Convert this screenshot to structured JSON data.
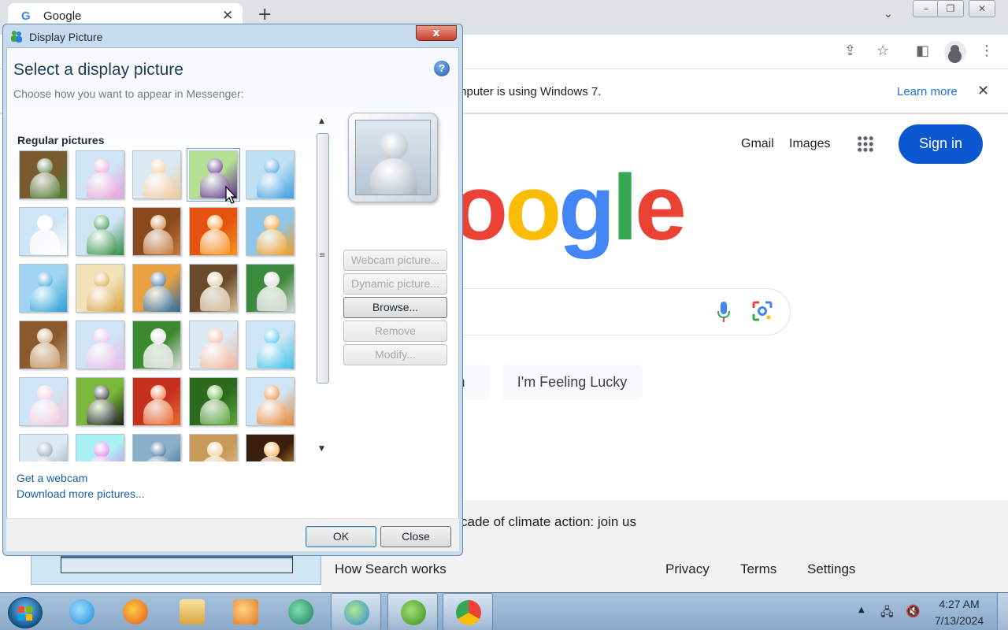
{
  "browser": {
    "tab_title": "Google",
    "tab_favicon": "G",
    "new_tab_symbol": "+",
    "infobar_text": "mputer is using Windows 7.",
    "learn_more": "Learn more",
    "icons": [
      "share-icon",
      "star-icon",
      "sidepanel-icon",
      "profile-icon",
      "kebab-menu-icon"
    ]
  },
  "google": {
    "gmail": "Gmail",
    "images": "Images",
    "sign_in": "Sign in",
    "logo_letters": [
      "o",
      "o",
      "g",
      "l",
      "e"
    ],
    "logo_colors": [
      "#ea4335",
      "#fbbc05",
      "#4285f4",
      "#34a853",
      "#ea4335"
    ],
    "search_button_partial": "ch",
    "lucky_button": "I'm Feeling Lucky",
    "climate_text": "cade of climate action: join us",
    "footer_links": [
      "How Search works",
      "Privacy",
      "Terms",
      "Settings"
    ],
    "accent": "#0b57d0"
  },
  "dialog": {
    "title": "Display Picture",
    "close_symbol": "x",
    "heading": "Select a display picture",
    "subheading": "Choose how you want to appear in Messenger:",
    "help_symbol": "?",
    "section_label": "Regular pictures",
    "pictures": [
      {
        "name": "bonsai",
        "colors": [
          "#7a5a2e",
          "#4f7a34"
        ]
      },
      {
        "name": "surfer",
        "colors": [
          "#cfe5f5",
          "#e8a0d8"
        ]
      },
      {
        "name": "tennis",
        "colors": [
          "#dbe9f3",
          "#f2c89b"
        ]
      },
      {
        "name": "doll",
        "colors": [
          "#b3e093",
          "#5c2a8c"
        ]
      },
      {
        "name": "basketball-23",
        "colors": [
          "#bfe0f3",
          "#3c9be0"
        ]
      },
      {
        "name": "chef",
        "colors": [
          "#cfe5f5",
          "#ffffff"
        ]
      },
      {
        "name": "business",
        "colors": [
          "#cfe5f5",
          "#2c8c3c"
        ]
      },
      {
        "name": "suitcase",
        "colors": [
          "#8a4a1e",
          "#c47a3a"
        ]
      },
      {
        "name": "flower",
        "colors": [
          "#e6530e",
          "#f7931e"
        ]
      },
      {
        "name": "goldfish",
        "colors": [
          "#8ec7ea",
          "#f59a1e"
        ]
      },
      {
        "name": "beach",
        "colors": [
          "#9fd3ef",
          "#2a9fd6"
        ]
      },
      {
        "name": "autumn",
        "colors": [
          "#f3e2b8",
          "#d6a23c"
        ]
      },
      {
        "name": "bass-clef",
        "colors": [
          "#e8a040",
          "#2c6a9c"
        ]
      },
      {
        "name": "chess",
        "colors": [
          "#6a4a2a",
          "#d9c29a"
        ]
      },
      {
        "name": "soccer-fan",
        "colors": [
          "#3c8a3c",
          "#d8d8d8"
        ]
      },
      {
        "name": "kitten",
        "colors": [
          "#8a5a2e",
          "#c89a6a"
        ]
      },
      {
        "name": "guitar",
        "colors": [
          "#cfe5f5",
          "#e8b8e8"
        ]
      },
      {
        "name": "soccer-ball",
        "colors": [
          "#3c8a2e",
          "#e0e0e0"
        ]
      },
      {
        "name": "blocks",
        "colors": [
          "#dbe9f3",
          "#f2b49b"
        ]
      },
      {
        "name": "rocker",
        "colors": [
          "#cfe5f5",
          "#40c0e8"
        ]
      },
      {
        "name": "meditate",
        "colors": [
          "#cfe5f5",
          "#f2c8d8"
        ]
      },
      {
        "name": "cartoon-boy",
        "colors": [
          "#7ab83c",
          "#1c1c1c"
        ]
      },
      {
        "name": "starfish",
        "colors": [
          "#c8301e",
          "#e86a2e"
        ]
      },
      {
        "name": "leaf",
        "colors": [
          "#2c6a1e",
          "#5ca83c"
        ]
      },
      {
        "name": "beach-chair",
        "colors": [
          "#cfe5f5",
          "#e8842e"
        ]
      },
      {
        "name": "skateboard",
        "colors": [
          "#dbe9f3",
          "#8a9aa8"
        ]
      },
      {
        "name": "sparkle",
        "colors": [
          "#a8f0f3",
          "#e070e8"
        ]
      },
      {
        "name": "robot",
        "colors": [
          "#8ab0c8",
          "#2a5a8a"
        ]
      },
      {
        "name": "puppy",
        "colors": [
          "#c89a5a",
          "#e8c890"
        ]
      },
      {
        "name": "lights",
        "colors": [
          "#3a1e0e",
          "#f2a83c"
        ]
      }
    ],
    "buttons": [
      {
        "label": "Webcam picture...",
        "enabled": false
      },
      {
        "label": "Dynamic picture...",
        "enabled": false
      },
      {
        "label": "Browse...",
        "enabled": true
      },
      {
        "label": "Remove",
        "enabled": false
      },
      {
        "label": "Modify...",
        "enabled": false
      }
    ],
    "links": [
      "Get a webcam",
      "Download more pictures..."
    ],
    "ok": "OK",
    "close": "Close"
  },
  "taskbar": {
    "apps": [
      "internet-explorer",
      "firefox",
      "file-explorer",
      "media-player",
      "app-green-circle",
      "messenger",
      "utorrent",
      "chrome"
    ],
    "active_apps": [
      "messenger",
      "utorrent",
      "chrome"
    ],
    "time": "4:27 AM",
    "date": "7/13/2024",
    "tray_arrow": "▲"
  }
}
